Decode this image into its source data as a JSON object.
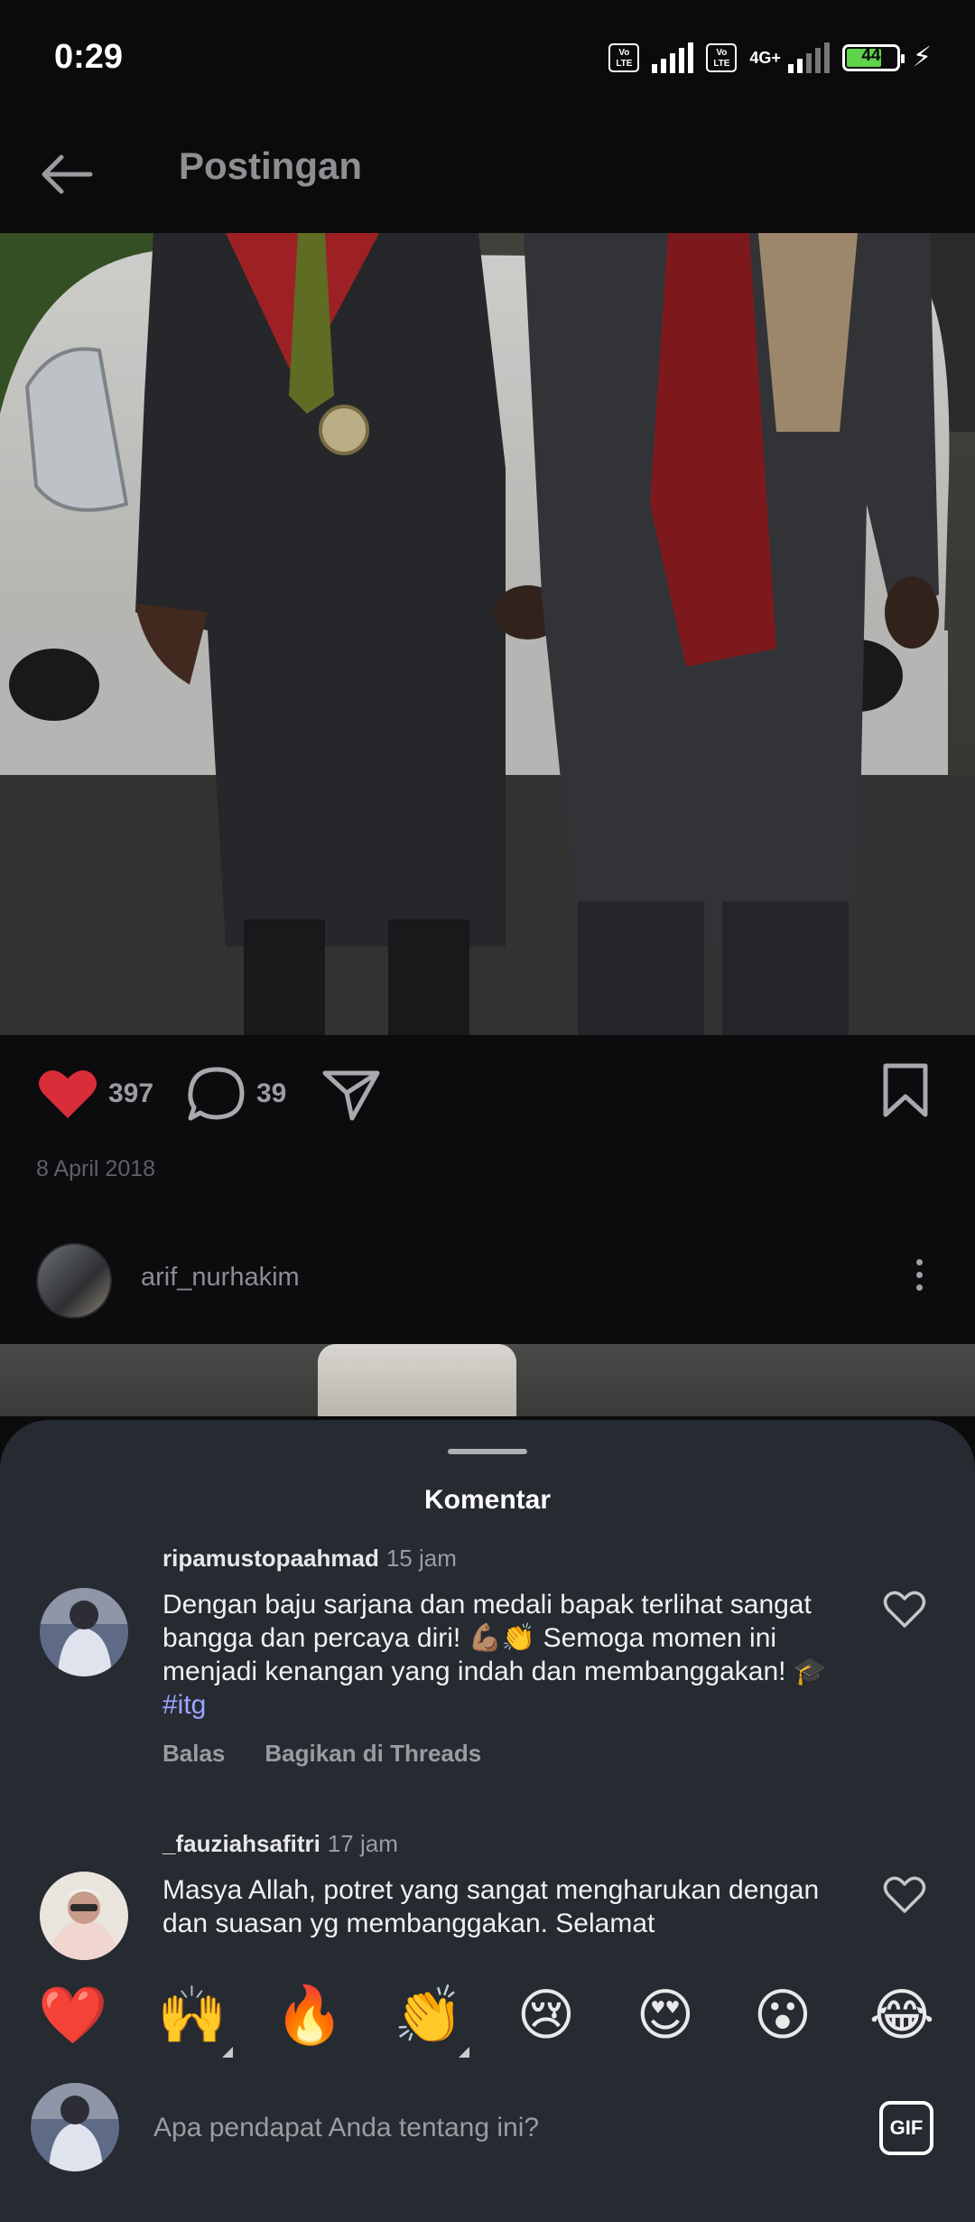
{
  "status_bar": {
    "time": "0:29",
    "sim1_badge": "Vo LTE",
    "sim2_badge": "Vo LTE",
    "network_type": "4G+",
    "battery_level": "44",
    "charging": true
  },
  "header": {
    "title": "Postingan",
    "back_icon": "arrow-left-icon"
  },
  "post": {
    "likes": "397",
    "comments": "39",
    "date": "8 April 2018",
    "liked": true,
    "colors": {
      "like": "#d92d3a"
    }
  },
  "next_post": {
    "username": "arif_nurhakim"
  },
  "comments_sheet": {
    "title": "Komentar",
    "comments": [
      {
        "username": "ripamustopaahmad",
        "time": "15 jam",
        "text_main": "Dengan baju sarjana dan medali bapak terlihat sangat bangga dan percaya diri! 💪🏽👏 Semoga momen ini menjadi kenangan yang indah dan membanggakan!",
        "text_prefix": "🎓",
        "hashtag": "#itg",
        "reply_label": "Balas",
        "share_label": "Bagikan di Threads"
      },
      {
        "username": "_fauziahsafitri",
        "time": "17 jam",
        "text_main": "Masya Allah, potret yang sangat mengharukan dengan dan suasan yg membanggakan. Selamat"
      }
    ],
    "emoji_reactions": [
      "❤️",
      "🙌",
      "🔥",
      "👏",
      "😢",
      "😍",
      "😮",
      "😂"
    ],
    "composer": {
      "placeholder": "Apa pendapat Anda tentang ini?",
      "gif_label": "GIF"
    }
  }
}
